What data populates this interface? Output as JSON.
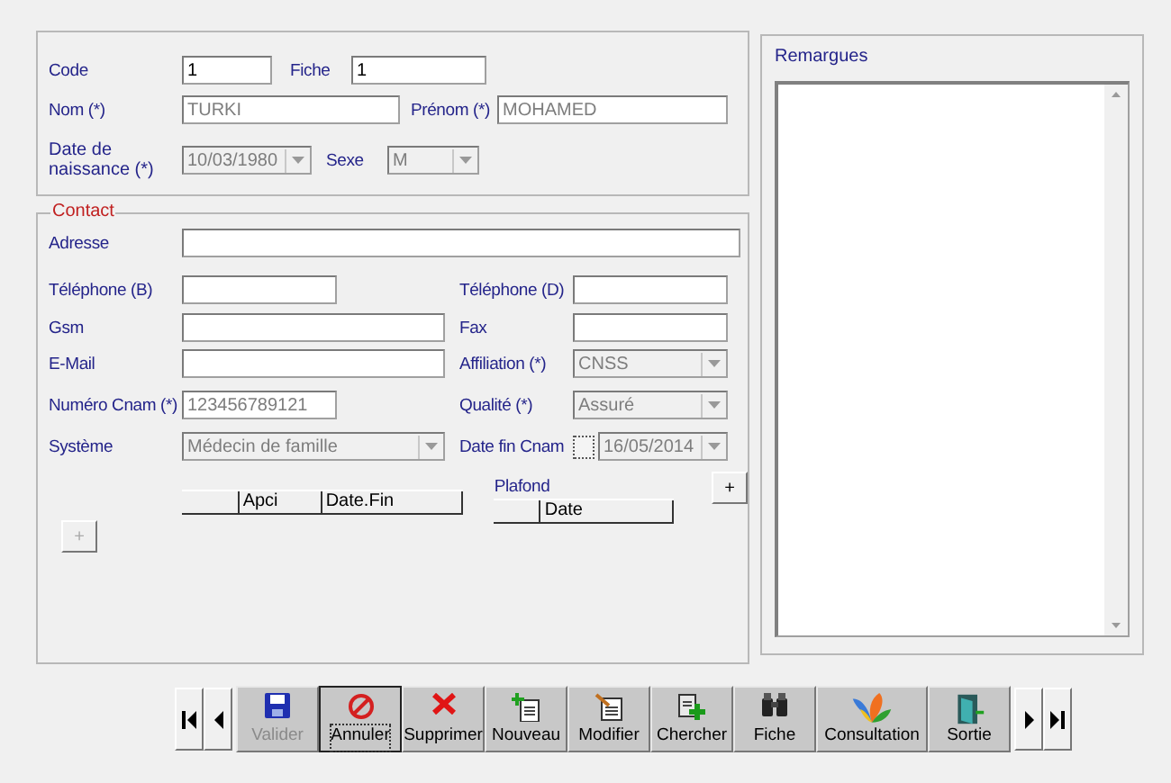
{
  "identity": {
    "code": {
      "label": "Code",
      "value": "1",
      "disabled": false
    },
    "fiche": {
      "label": "Fiche",
      "value": "1",
      "disabled": false
    },
    "nom": {
      "label": "Nom (*)",
      "value": "TURKI",
      "disabled": true
    },
    "prenom": {
      "label": "Prénom (*)",
      "value": "MOHAMED",
      "disabled": true
    },
    "date_naissance": {
      "label": "Date de naissance (*)",
      "value": "10/03/1980",
      "disabled": true
    },
    "sexe": {
      "label": "Sexe",
      "value": "M",
      "disabled": true
    }
  },
  "contact": {
    "title": "Contact",
    "adresse": {
      "label": "Adresse"
    },
    "telephone_b": {
      "label": "Téléphone (B)"
    },
    "telephone_d": {
      "label": "Téléphone (D)"
    },
    "gsm": {
      "label": "Gsm"
    },
    "fax": {
      "label": "Fax"
    },
    "email": {
      "label": "E-Mail"
    },
    "affiliation": {
      "label": "Affiliation (*)",
      "value": "CNSS",
      "disabled": true
    },
    "numero_cnam": {
      "label": "Numéro Cnam (*)",
      "value": "123456789121",
      "disabled": true
    },
    "qualite": {
      "label": "Qualité (*)",
      "value": "Assuré",
      "disabled": true
    },
    "systeme": {
      "label": "Système",
      "value": "Médecin de famille",
      "disabled": true
    },
    "date_fin_cnam": {
      "label": "Date fin Cnam",
      "value": "16/05/2014",
      "disabled": true,
      "checked": false
    },
    "apci_grid": {
      "columns": [
        "Apci",
        "Date.Fin"
      ]
    },
    "plafond": {
      "label": "Plafond",
      "columns": [
        "Date"
      ]
    },
    "add_buttons": [
      {
        "label": "+",
        "disabled": false
      },
      {
        "label": "+",
        "disabled": true
      }
    ]
  },
  "remarques": {
    "label": "Remargues"
  },
  "toolbar": [
    {
      "kind": "save",
      "label": "Valider",
      "disabled": true,
      "focused": false
    },
    {
      "kind": "cancel",
      "label": "Annuler",
      "disabled": false,
      "focused": true
    },
    {
      "kind": "delete",
      "label": "Supprimer",
      "disabled": false,
      "focused": false
    },
    {
      "kind": "new",
      "label": "Nouveau",
      "disabled": false,
      "focused": false
    },
    {
      "kind": "edit",
      "label": "Modifier",
      "disabled": false,
      "focused": false
    },
    {
      "kind": "search",
      "label": "Chercher",
      "disabled": false,
      "focused": false
    },
    {
      "kind": "file",
      "label": "Fiche",
      "disabled": false,
      "focused": false
    },
    {
      "kind": "consult",
      "label": "Consultation",
      "disabled": false,
      "focused": false
    },
    {
      "kind": "exit",
      "label": "Sortie",
      "disabled": false,
      "focused": false
    }
  ]
}
